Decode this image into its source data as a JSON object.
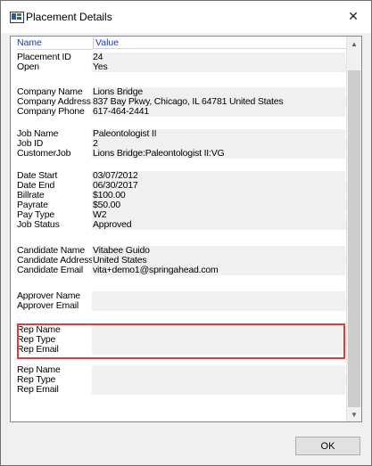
{
  "window": {
    "title": "Placement Details",
    "close_glyph": "✕"
  },
  "columns": {
    "name": "Name",
    "value": "Value"
  },
  "groups": [
    [
      {
        "name": "Placement ID",
        "value": "24"
      },
      {
        "name": "Open",
        "value": "Yes"
      }
    ],
    [
      {
        "name": "Company Name",
        "value": "Lions Bridge"
      },
      {
        "name": "Company Address",
        "value": "837 Bay Pkwy, Chicago, IL 64781 United States"
      },
      {
        "name": "Company Phone",
        "value": "617-464-2441"
      }
    ],
    [
      {
        "name": "Job Name",
        "value": "Paleontologist II"
      },
      {
        "name": "Job ID",
        "value": "2"
      },
      {
        "name": "CustomerJob",
        "value": "Lions Bridge:Paleontologist II:VG"
      }
    ],
    [
      {
        "name": "Date Start",
        "value": "03/07/2012"
      },
      {
        "name": "Date End",
        "value": "06/30/2017"
      },
      {
        "name": "Billrate",
        "value": "$100.00"
      },
      {
        "name": "Payrate",
        "value": "$50.00"
      },
      {
        "name": "Pay Type",
        "value": "W2"
      },
      {
        "name": "Job Status",
        "value": "Approved"
      }
    ],
    [
      {
        "name": "Candidate Name",
        "value": "Vitabee Guido"
      },
      {
        "name": "Candidate Address",
        "value": "United States"
      },
      {
        "name": "Candidate Email",
        "value": "vita+demo1@springahead.com"
      }
    ],
    [
      {
        "name": "Approver Name",
        "value": ""
      },
      {
        "name": "Approver Email",
        "value": ""
      }
    ],
    [
      {
        "name": "Rep Name",
        "value": ""
      },
      {
        "name": "Rep Type",
        "value": ""
      },
      {
        "name": "Rep Email",
        "value": ""
      }
    ],
    [
      {
        "name": "Rep Name",
        "value": ""
      },
      {
        "name": "Rep Type",
        "value": ""
      },
      {
        "name": "Rep Email",
        "value": ""
      }
    ]
  ],
  "highlighted_group_index": 6,
  "buttons": {
    "ok": "OK"
  },
  "icons": {
    "app": "placement-app-icon",
    "close": "close-icon",
    "scroll_up": "chevron-up-icon",
    "scroll_down": "chevron-down-icon"
  },
  "colors": {
    "header_text": "#1a3aa8",
    "highlight_border": "#e0393e",
    "row_shade": "#f0f0f0"
  }
}
